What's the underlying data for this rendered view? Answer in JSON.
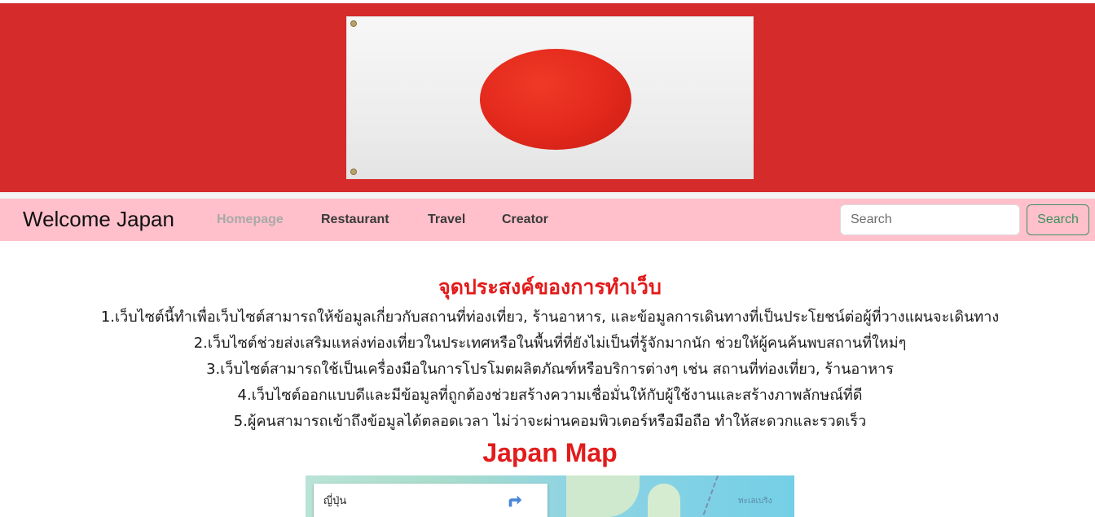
{
  "navbar": {
    "brand": "Welcome Japan",
    "links": [
      {
        "label": "Homepage",
        "active": true
      },
      {
        "label": "Restaurant",
        "active": false
      },
      {
        "label": "Travel",
        "active": false
      },
      {
        "label": "Creator",
        "active": false
      }
    ],
    "search": {
      "placeholder": "Search",
      "value": "",
      "button_label": "Search"
    }
  },
  "purpose": {
    "heading": "จุดประสงค์ของการทำเว็บ",
    "items": [
      "1.เว็บไซต์นี้ทำเพื่อเว็บไซต์สามารถให้ข้อมูลเกี่ยวกับสถานที่ท่องเที่ยว, ร้านอาหาร, และข้อมูลการเดินทางที่เป็นประโยชน์ต่อผู้ที่วางแผนจะเดินทาง",
      "2.เว็บไซต์ช่วยส่งเสริมแหล่งท่องเที่ยวในประเทศหรือในพื้นที่ที่ยังไม่เป็นที่รู้จักมากนัก ช่วยให้ผู้คนค้นพบสถานที่ใหม่ๆ",
      "3.เว็บไซต์สามารถใช้เป็นเครื่องมือในการโปรโมตผลิตภัณฑ์หรือบริการต่างๆ เช่น สถานที่ท่องเที่ยว, ร้านอาหาร",
      "4.เว็บไซต์ออกแบบดีและมีข้อมูลที่ถูกต้องช่วยสร้างความเชื่อมั่นให้กับผู้ใช้งานและสร้างภาพลักษณ์ที่ดี",
      "5.ผู้คนสามารถเข้าถึงข้อมูลได้ตลอดเวลา ไม่ว่าจะผ่านคอมพิวเตอร์หรือมือถือ ทำให้สะดวกและรวดเร็ว"
    ]
  },
  "map": {
    "heading": "Japan Map",
    "place_name": "ญี่ปุ่น",
    "sea_label": "ทะเลเบริง"
  },
  "colors": {
    "banner_red": "#d62b2b",
    "navbar_pink": "#ffc0cb",
    "heading_red": "#e31b1b",
    "search_green": "#3f8f5d"
  },
  "icons": {
    "directions": "directions-icon"
  }
}
